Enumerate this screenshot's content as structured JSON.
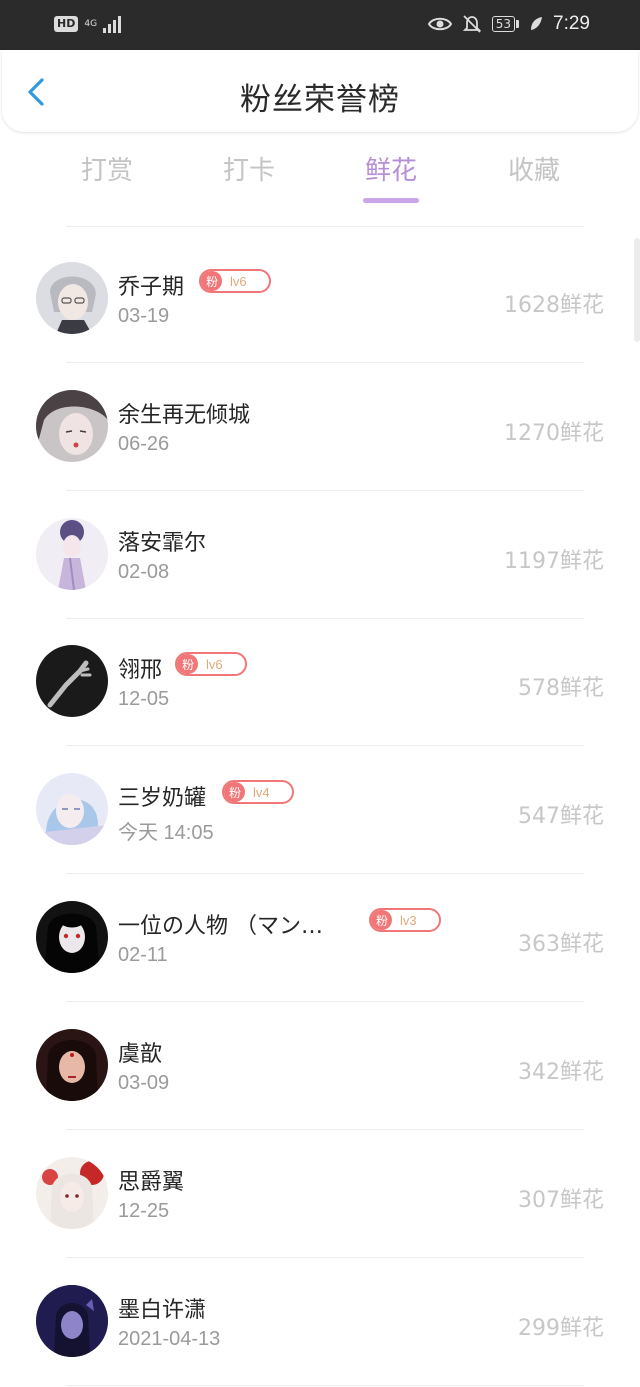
{
  "status_bar": {
    "hd": "HD",
    "network": "4G",
    "battery": "53",
    "time": "7:29"
  },
  "header": {
    "title": "粉丝荣誉榜"
  },
  "tabs": [
    {
      "label": "打赏",
      "active": false
    },
    {
      "label": "打卡",
      "active": false
    },
    {
      "label": "鲜花",
      "active": true
    },
    {
      "label": "收藏",
      "active": false
    }
  ],
  "fans": [
    {
      "name": "乔子期",
      "date": "03-19",
      "badge": {
        "fan": "粉",
        "level": "lv6"
      },
      "count": "1628鲜花"
    },
    {
      "name": "余生再无倾城",
      "date": "06-26",
      "badge": null,
      "count": "1270鲜花"
    },
    {
      "name": "落安霏尔",
      "date": "02-08",
      "badge": null,
      "count": "1197鲜花"
    },
    {
      "name": "翎邢",
      "date": "12-05",
      "badge": {
        "fan": "粉",
        "level": "lv6"
      },
      "count": "578鲜花"
    },
    {
      "name": "三岁奶罐",
      "date": "今天 14:05",
      "badge": {
        "fan": "粉",
        "level": "lv4"
      },
      "count": "547鲜花"
    },
    {
      "name": "一位の人物 （マン…",
      "date": "02-11",
      "badge": {
        "fan": "粉",
        "level": "lv3"
      },
      "count": "363鲜花"
    },
    {
      "name": "虞歆",
      "date": "03-09",
      "badge": null,
      "count": "342鲜花"
    },
    {
      "name": "思爵翼",
      "date": "12-25",
      "badge": null,
      "count": "307鲜花"
    },
    {
      "name": "墨白许潇",
      "date": "2021-04-13",
      "badge": null,
      "count": "299鲜花"
    }
  ],
  "colors": {
    "accent": "#b78fd8",
    "badge": "#f07678",
    "back_arrow": "#2f9ae0"
  }
}
